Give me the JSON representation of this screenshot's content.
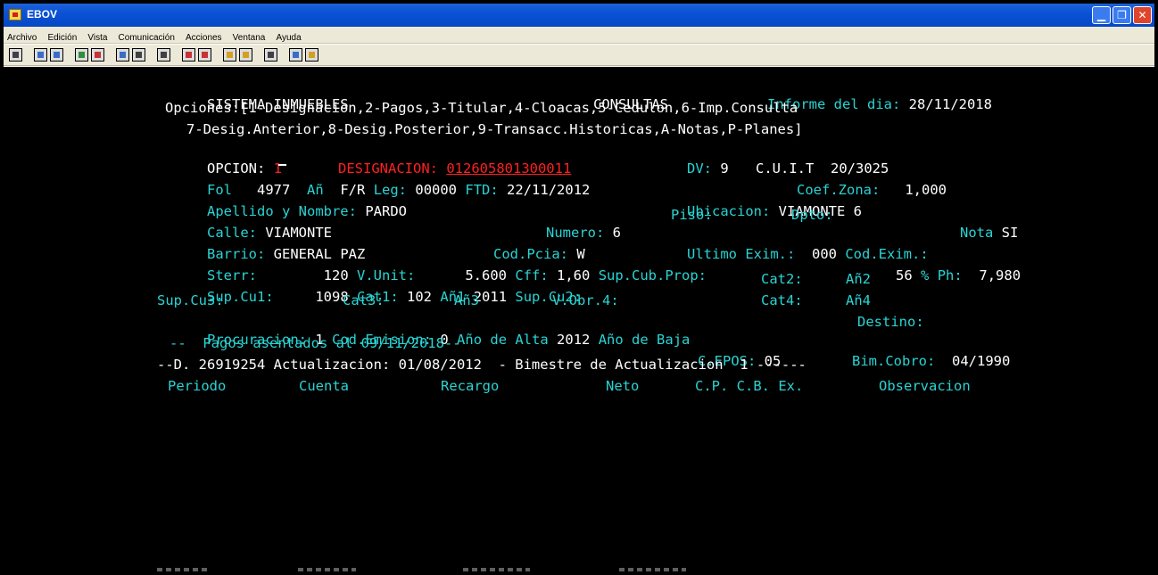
{
  "window": {
    "title": "EBOV"
  },
  "menu": [
    "Archivo",
    "Edición",
    "Vista",
    "Comunicación",
    "Acciones",
    "Ventana",
    "Ayuda"
  ],
  "toolbar_icons": [
    "connect-icon",
    "copy-icon",
    "paste-icon",
    "transfer-send-icon",
    "transfer-receive-icon",
    "screen-icon",
    "display-icon",
    "macro-icon",
    "record-icon",
    "play-icon",
    "keyboard-map-icon",
    "color-map-icon",
    "print-icon",
    "help-icon",
    "edit-icon"
  ],
  "terminal": {
    "system": "SISTEMA INMUEBLES",
    "screen": "CONSULTAS",
    "report_label": "Informe del dia:",
    "report_date": "28/11/2018",
    "options_1": "Opciones:[1-Designacion,2-Pagos,3-Titular,4-Cloacas,5-Cedulon,6-Imp.Consulta",
    "options_2": "7-Desig.Anterior,8-Desig.Posterior,9-Transacc.Historicas,A-Notas,P-Planes]",
    "opcion_label": "OPCION:",
    "opcion_value": "1",
    "designacion_label": "DESIGNACION:",
    "designacion_value": "012605801300011",
    "dv_label": "DV:",
    "dv_value": "9",
    "cuit_label": "C.U.I.T",
    "cuit_value": "20/3025",
    "fol_label": "Fol",
    "fol_value": "4977",
    "an_label": "Añ",
    "fr_label": "F/R",
    "leg_label": "Leg:",
    "leg_value": "00000",
    "ftd_label": "FTD:",
    "ftd_value": "22/11/2012",
    "coef_label": "Coef.Zona:",
    "coef_value": "1,000",
    "apellido_label": "Apellido y Nombre:",
    "apellido_value": "PARDO",
    "ubicacion_label": "Ubicacion:",
    "ubicacion_value": "VIAMONTE 6",
    "calle_label": "Calle:",
    "calle_value": "VIAMONTE",
    "numero_label": "Numero:",
    "numero_value": "6",
    "piso_label": "Piso:",
    "dpto_label": "Dpto:",
    "nota_label": "Nota",
    "nota_value": "SI",
    "barrio_label": "Barrio:",
    "barrio_value": "GENERAL PAZ",
    "codpcia_label": "Cod.Pcia:",
    "codpcia_value": "W",
    "ultimo_label": "Ultimo Exim.:",
    "ultimo_value": "000",
    "codexim_label": "Cod.Exim.:",
    "sterr_label": "Sterr:",
    "sterr_value": "120",
    "vunit_label": "V.Unit:",
    "vunit_value": "5.600",
    "cff_label": "Cff:",
    "cff_value": "1,60",
    "supcub_label": "Sup.Cub.Prop:",
    "supcub_value": "56",
    "pct_label": "%",
    "ph_label": "Ph:",
    "ph_value": "7,980",
    "supcu1_label": "Sup.Cu1:",
    "supcu1_value": "1098",
    "cat1_label": "Cat1:",
    "cat1_value": "102",
    "an1_label": "Añ1",
    "an1_value": "2011",
    "supcu2_label": "Sup.Cu2:",
    "cat2_label": "Cat2:",
    "an2_label": "Añ2",
    "supcu3_label": "Sup.Cu3:",
    "cat3_label": "Cat3:",
    "an3_label": "Añ3",
    "vobr4_label": "V.Obr.4:",
    "cat4_label": "Cat4:",
    "an4_label": "Añ4",
    "procuracion_label": "Procuracion:",
    "procuracion_value": "1",
    "codemision_label": "Cod.Emision:",
    "codemision_value": "0",
    "anoalta_label": "Año de Alta",
    "anoalta_value": "2012",
    "anobaja_label": "Año de Baja",
    "destino_label": "Destino:",
    "pagos_label": "--  Pagos asentados al 09/11/2018--",
    "cepos_label": "C.EPOS:",
    "cepos_value": "05",
    "bimcobro_label": "Bim.Cobro:",
    "bimcobro_value": "04/1990",
    "actualizacion_line": "--D. 26919254 Actualizacion: 01/08/2012  - Bimestre de Actualizacion  1 ------",
    "columns": [
      "Periodo",
      "Cuenta",
      "Recargo",
      "Neto",
      "C.P. C.B. Ex.",
      "Observacion"
    ]
  }
}
